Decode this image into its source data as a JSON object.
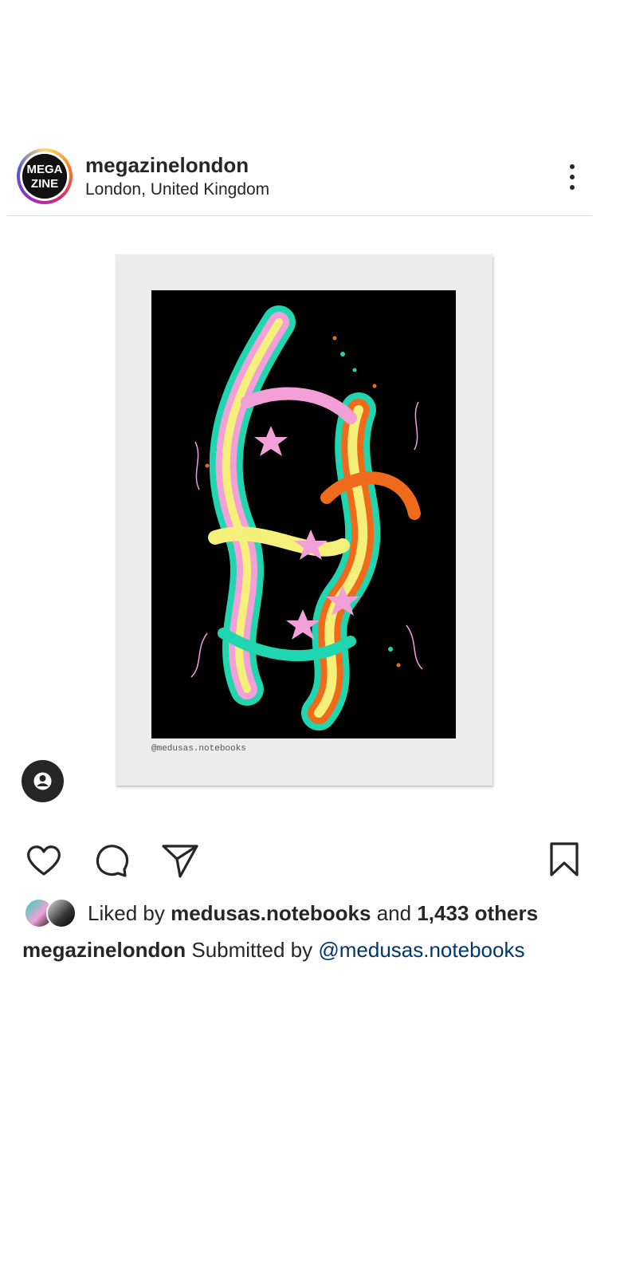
{
  "post": {
    "username": "megazinelondon",
    "location": "London, United Kingdom",
    "avatar_text": "MEGA ZINE",
    "media": {
      "credit": "@medusas.notebooks",
      "palette": {
        "background": "#000000",
        "frame": "#ececec",
        "pink": "#f3a0d8",
        "yellow": "#f5f07a",
        "teal": "#20d6b0",
        "orange": "#f06a1c"
      }
    },
    "likes": {
      "prefix": "Liked by",
      "user": "medusas.notebooks",
      "conjunction": "and",
      "others": "1,433 others"
    },
    "caption": {
      "username": "megazinelondon",
      "text": "Submitted by",
      "mention": "@medusas.notebooks"
    }
  },
  "icons": {
    "more": "more-vertical-icon",
    "tag": "user-tag-icon",
    "like": "heart-icon",
    "comment": "comment-icon",
    "share": "send-icon",
    "save": "bookmark-icon"
  }
}
